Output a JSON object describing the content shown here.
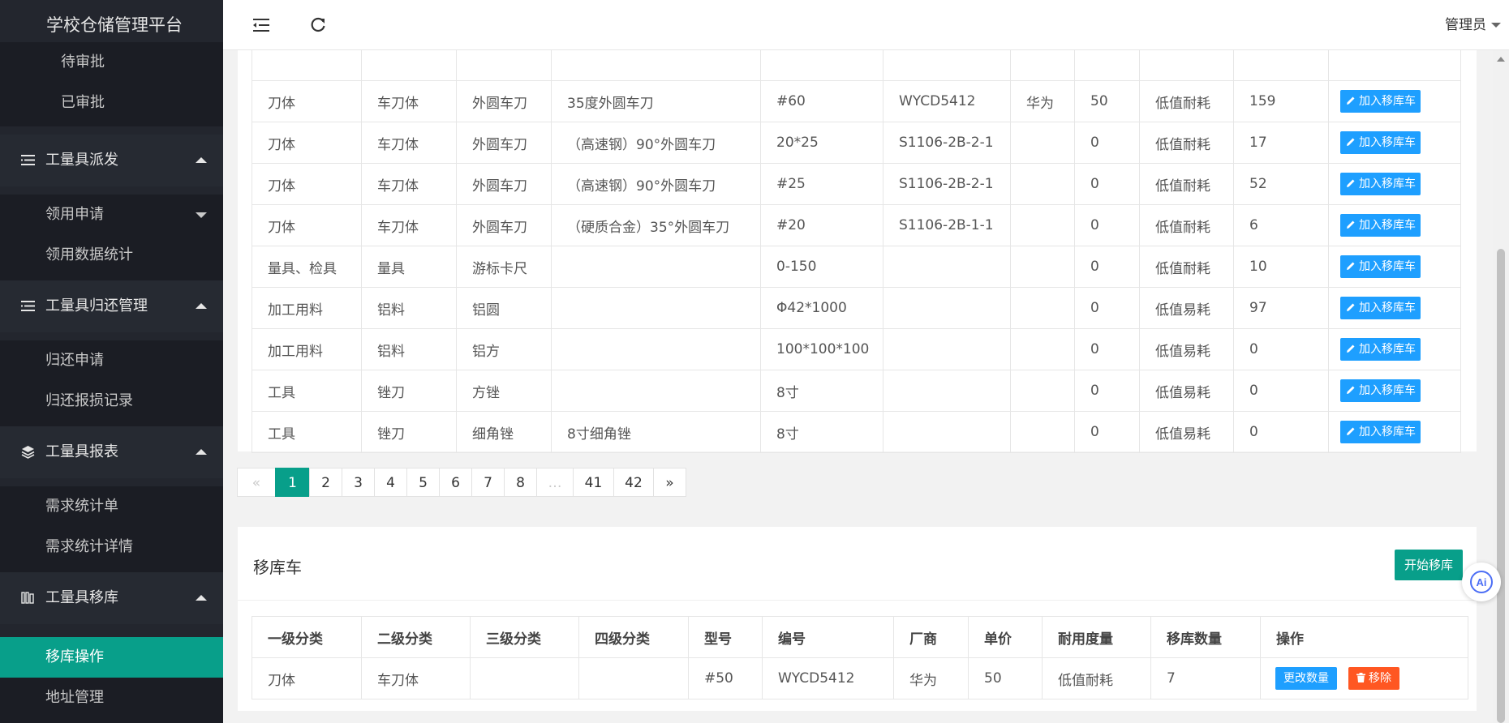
{
  "sidebar": {
    "title": "学校仓储管理平台",
    "items": [
      {
        "label": "待审批"
      },
      {
        "label": "已审批"
      },
      {
        "label": "工量具派发"
      },
      {
        "label": "领用申请"
      },
      {
        "label": "领用数据统计"
      },
      {
        "label": "工量具归还管理"
      },
      {
        "label": "归还申请"
      },
      {
        "label": "归还报损记录"
      },
      {
        "label": "工量具报表"
      },
      {
        "label": "需求统计单"
      },
      {
        "label": "需求统计详情"
      },
      {
        "label": "工量具移库"
      },
      {
        "label": "移库操作"
      },
      {
        "label": "地址管理"
      }
    ]
  },
  "header": {
    "user": "管理员"
  },
  "stock_table": {
    "button_label": "加入移库车",
    "rows": [
      [
        "刀体",
        "车刀体",
        "外圆车刀",
        "35度外圆车刀",
        "#60",
        "WYCD5412",
        "华为",
        "50",
        "低值耐耗",
        "159"
      ],
      [
        "刀体",
        "车刀体",
        "外圆车刀",
        "（高速钢）90°外圆车刀",
        "20*25",
        "S1106-2B-2-1",
        "",
        "0",
        "低值耐耗",
        "17"
      ],
      [
        "刀体",
        "车刀体",
        "外圆车刀",
        "（高速钢）90°外圆车刀",
        "#25",
        "S1106-2B-2-1",
        "",
        "0",
        "低值耐耗",
        "52"
      ],
      [
        "刀体",
        "车刀体",
        "外圆车刀",
        "（硬质合金）35°外圆车刀",
        "#20",
        "S1106-2B-1-1",
        "",
        "0",
        "低值耐耗",
        "6"
      ],
      [
        "量具、检具",
        "量具",
        "游标卡尺",
        "",
        "0-150",
        "",
        "",
        "0",
        "低值耐耗",
        "10"
      ],
      [
        "加工用料",
        "铝料",
        "铝圆",
        "",
        "Φ42*1000",
        "",
        "",
        "0",
        "低值易耗",
        "97"
      ],
      [
        "加工用料",
        "铝料",
        "铝方",
        "",
        "100*100*100",
        "",
        "",
        "0",
        "低值易耗",
        "0"
      ],
      [
        "工具",
        "锉刀",
        "方锉",
        "",
        "8寸",
        "",
        "",
        "0",
        "低值易耗",
        "0"
      ],
      [
        "工具",
        "锉刀",
        "细角锉",
        "8寸细角锉",
        "8寸",
        "",
        "",
        "0",
        "低值易耗",
        "0"
      ]
    ]
  },
  "pagination": {
    "prev": "«",
    "pages": [
      "1",
      "2",
      "3",
      "4",
      "5",
      "6",
      "7",
      "8",
      "…",
      "41",
      "42"
    ],
    "current": "1",
    "next": "»"
  },
  "cart": {
    "title": "移库车",
    "start_button": "开始移库",
    "columns": [
      "一级分类",
      "二级分类",
      "三级分类",
      "四级分类",
      "型号",
      "编号",
      "厂商",
      "单价",
      "耐用度量",
      "移库数量",
      "操作"
    ],
    "rows": [
      [
        "刀体",
        "车刀体",
        "",
        "",
        "#50",
        "WYCD5412",
        "华为",
        "50",
        "低值耐耗",
        "7"
      ]
    ],
    "edit_label": "更改数量",
    "remove_label": "移除"
  },
  "floating": {
    "label": "Ai"
  },
  "colors": {
    "sidebar_bg": "#23262e",
    "active": "#089f8a",
    "primary_btn": "#1e9fff",
    "danger_btn": "#ff5722"
  }
}
